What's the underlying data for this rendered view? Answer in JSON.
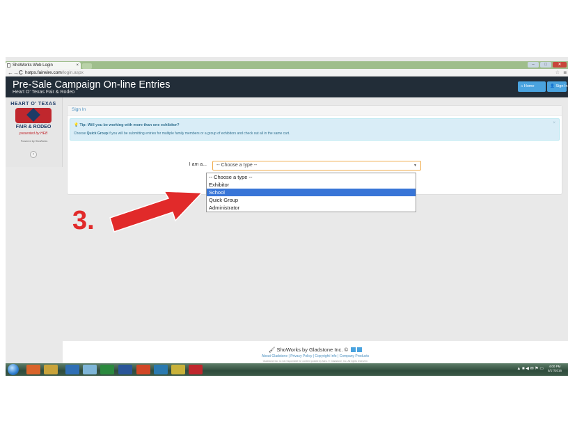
{
  "browser": {
    "tab_title": "ShoWorks Web Login",
    "tab_close": "×",
    "url_protocol": "",
    "url_host": "hotps.fairwire.com",
    "url_path": "/login.aspx",
    "back": "←",
    "forward": "→",
    "reload": "C",
    "star": "☆",
    "menu": "≡"
  },
  "header": {
    "title": "Pre-Sale Campaign On-line Entries",
    "subtitle": "Heart O' Texas Fair & Rodeo",
    "home_label": "⌂ Home",
    "signin_label": "👤 Sign In"
  },
  "sidebar": {
    "logo_line1": "HEART O' TEXAS",
    "logo_line2": "FAIR & RODEO",
    "logo_line3": "presented by HEB",
    "powered": "Powered by ShoWorks",
    "collapse": "‹"
  },
  "panel": {
    "heading": "Sign In",
    "tip_title": "Tip: Will you be working with more than one exhibitor?",
    "tip_pre": "Choose ",
    "tip_bold": "Quick Group",
    "tip_post": " if you will be submitting entries for multiple family members or a group of exhibitors and check out all in the same cart.",
    "tip_close": "×",
    "iam_label": "I am a...",
    "select_value": "-- Choose a type --",
    "select_caret": "▼",
    "options": [
      "-- Choose a type --",
      "Exhibitor",
      "School",
      "Quick Group",
      "Administrator"
    ],
    "highlighted_option": "School"
  },
  "annotation": {
    "step_label": "3."
  },
  "footer": {
    "brand": "ShoWorks by Gladstone Inc. ©",
    "links": "About Gladstone | Privacy Policy | Copyright Info | Company Products",
    "disclaimer": "Gladstone Inc. is not responsible for content posted by fairs. © Gladstone, Inc. All rights reserved."
  },
  "taskbar": {
    "time": "4:00 PM",
    "date": "5/17/2016"
  },
  "colors": {
    "header_bg": "#222d38",
    "accent_blue": "#4aa3df",
    "annotation_red": "#e12a2a",
    "highlight": "#3875d7"
  }
}
